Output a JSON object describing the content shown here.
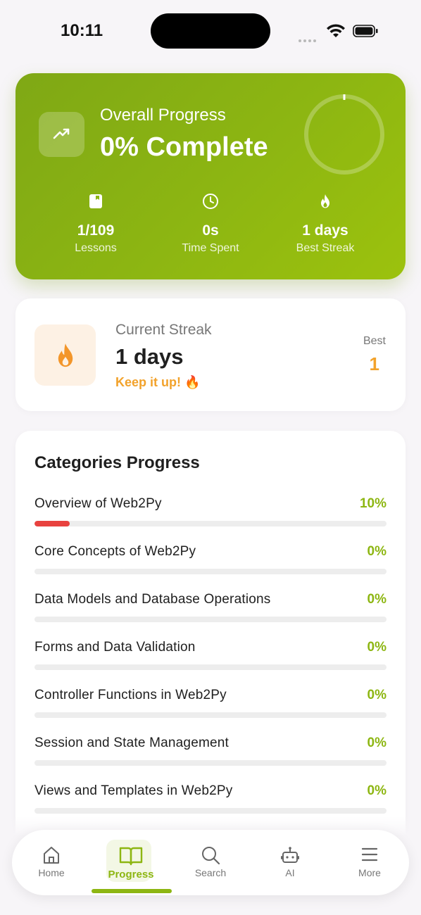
{
  "status": {
    "time": "10:11"
  },
  "overall": {
    "subtitle": "Overall Progress",
    "title": "0% Complete",
    "percent": 0,
    "stats": [
      {
        "icon": "book-icon",
        "value": "1/109",
        "label": "Lessons"
      },
      {
        "icon": "clock-icon",
        "value": "0s",
        "label": "Time Spent"
      },
      {
        "icon": "flame-icon",
        "value": "1 days",
        "label": "Best Streak"
      }
    ]
  },
  "streak": {
    "label": "Current Streak",
    "value": "1 days",
    "message": "Keep it up! 🔥",
    "best_label": "Best",
    "best_value": "1"
  },
  "categories": {
    "title": "Categories Progress",
    "items": [
      {
        "name": "Overview of Web2Py",
        "percent_label": "10%",
        "progress": 0.1
      },
      {
        "name": "Core Concepts of Web2Py",
        "percent_label": "0%",
        "progress": 0
      },
      {
        "name": "Data Models and Database Operations",
        "percent_label": "0%",
        "progress": 0
      },
      {
        "name": "Forms and Data Validation",
        "percent_label": "0%",
        "progress": 0
      },
      {
        "name": "Controller Functions in Web2Py",
        "percent_label": "0%",
        "progress": 0
      },
      {
        "name": "Session and State Management",
        "percent_label": "0%",
        "progress": 0
      },
      {
        "name": "Views and Templates in Web2Py",
        "percent_label": "0%",
        "progress": 0
      }
    ]
  },
  "nav": {
    "tabs": [
      {
        "label": "Home",
        "icon": "home-icon"
      },
      {
        "label": "Progress",
        "icon": "book-open-icon",
        "active": true
      },
      {
        "label": "Search",
        "icon": "search-icon"
      },
      {
        "label": "AI",
        "icon": "robot-icon"
      },
      {
        "label": "More",
        "icon": "menu-icon"
      }
    ]
  },
  "colors": {
    "accent": "#8db612",
    "streak": "#f2a22b",
    "bar_fill": "#e8423f"
  }
}
